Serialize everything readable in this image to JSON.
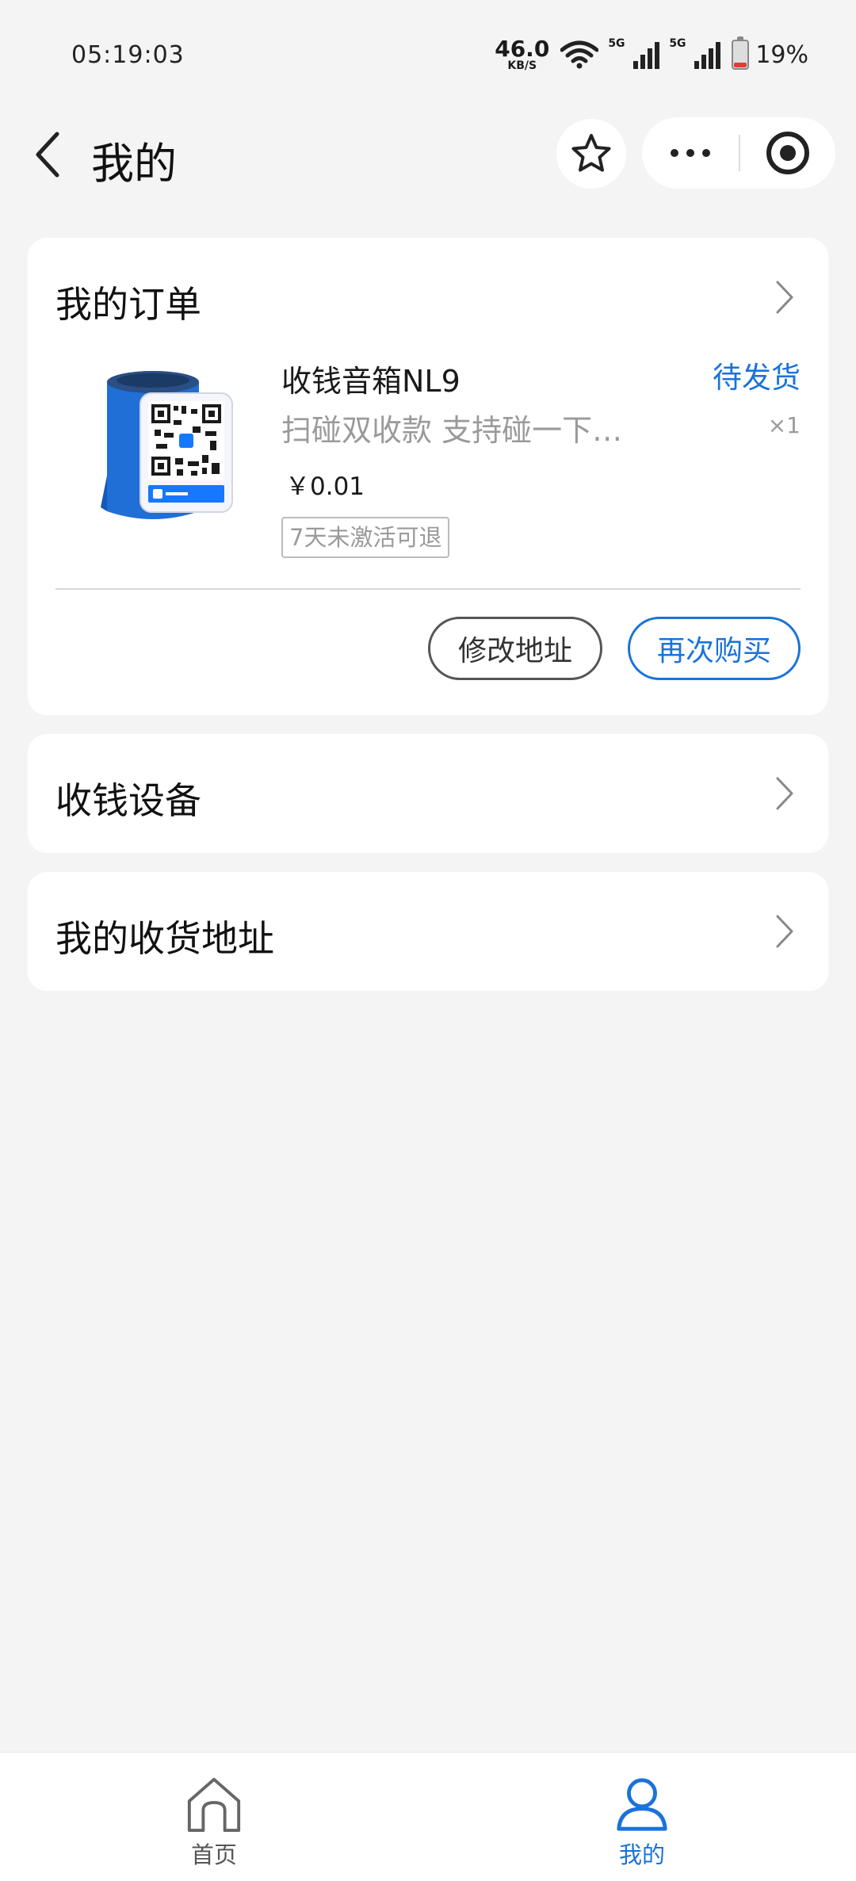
{
  "status_bar": {
    "time": "05:19:03",
    "net_speed_value": "46.0",
    "net_speed_unit": "KB/S",
    "signal_1_label": "5G",
    "signal_2_label": "5G",
    "battery_percent": "19%",
    "battery_level": 0.19,
    "battery_color": "#e53935"
  },
  "nav": {
    "title": "我的",
    "back_icon": "chevron-left-icon",
    "favorite_icon": "star-icon",
    "more_icon": "more-dots-icon",
    "close_icon": "target-circle-icon"
  },
  "order_card": {
    "title": "我的订单",
    "item": {
      "name": "收钱音箱NL9",
      "status": "待发货",
      "description": "扫碰双收款  支持碰一下…",
      "quantity": "×1",
      "price": "￥0.01",
      "tag": "7天未激活可退"
    },
    "buttons": {
      "change_address": "修改地址",
      "buy_again": "再次购买"
    }
  },
  "device_card": {
    "title": "收钱设备"
  },
  "address_card": {
    "title": "我的收货地址"
  },
  "tab_bar": {
    "home_label": "首页",
    "mine_label": "我的",
    "active_tab": "我的"
  },
  "colors": {
    "accent": "#1a73d9",
    "background": "#f4f4f4",
    "card": "#ffffff",
    "muted_text": "#9a9a9a"
  }
}
